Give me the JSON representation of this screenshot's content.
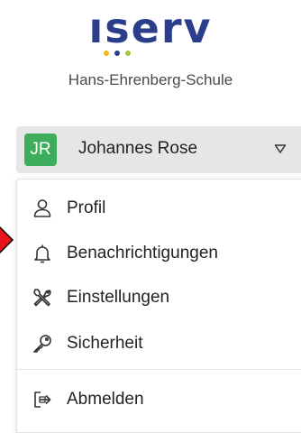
{
  "brand": {
    "logo_text": "ıserv",
    "dot_colors": [
      "#f2b71a",
      "#2b3e8c",
      "#a8c23a"
    ]
  },
  "school_name": "Hans-Ehrenberg-Schule",
  "user": {
    "initials": "JR",
    "name": "Johannes Rose",
    "avatar_color": "#3fae5c"
  },
  "menu": {
    "items": [
      {
        "label": "Profil",
        "icon": "user-icon"
      },
      {
        "label": "Benachrichtigungen",
        "icon": "bell-icon"
      },
      {
        "label": "Einstellungen",
        "icon": "tools-icon"
      },
      {
        "label": "Sicherheit",
        "icon": "key-icon"
      },
      {
        "label": "Abmelden",
        "icon": "logout-icon"
      }
    ]
  },
  "colors": {
    "accent": "#2b3e8c",
    "pointer_arrow": "#e8141a"
  }
}
